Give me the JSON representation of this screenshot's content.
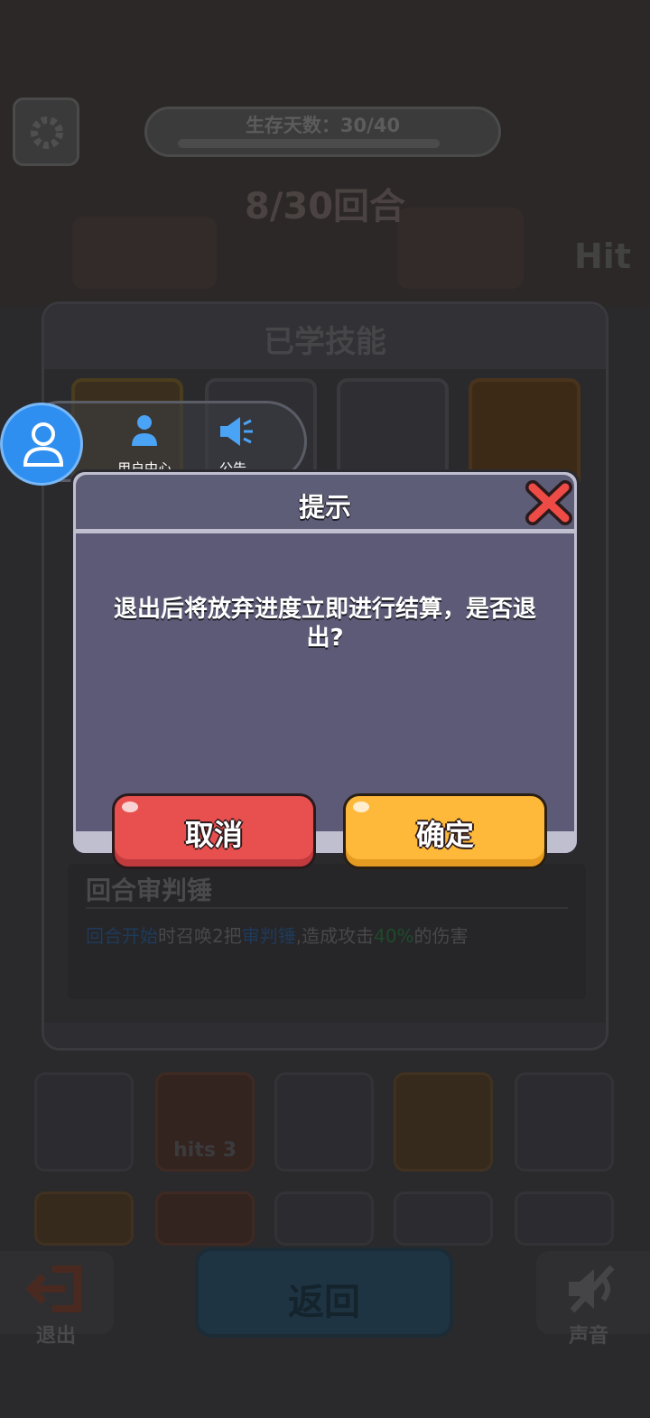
{
  "hud": {
    "survival_label": "生存天数：30/40",
    "round_label": "8/30回合",
    "hits_side": "Hit"
  },
  "skills_panel": {
    "title": "已学技能",
    "selected_skill": {
      "name": "回合审判锤",
      "desc_part1": "回合开始",
      "desc_part2": "时召唤2把",
      "desc_part3": "审判锤",
      "desc_part4": ",造成攻击",
      "desc_part5": "40%",
      "desc_part6": "的伤害"
    }
  },
  "inventory": {
    "hits_label": "hits 3"
  },
  "floating_bar": {
    "user_center_label": "用户中心",
    "announcement_label": "公告"
  },
  "dialog": {
    "title": "提示",
    "message": "退出后将放弃进度立即进行结算，是否退出?",
    "cancel_label": "取消",
    "confirm_label": "确定"
  },
  "bottom_bar": {
    "exit_label": "退出",
    "back_label": "返回",
    "sound_label": "声音"
  },
  "colors": {
    "cancel_button": "#e8504f",
    "confirm_button": "#ffb93a",
    "avatar_button": "#2e8ff0",
    "dialog_body": "#5c5a76"
  }
}
